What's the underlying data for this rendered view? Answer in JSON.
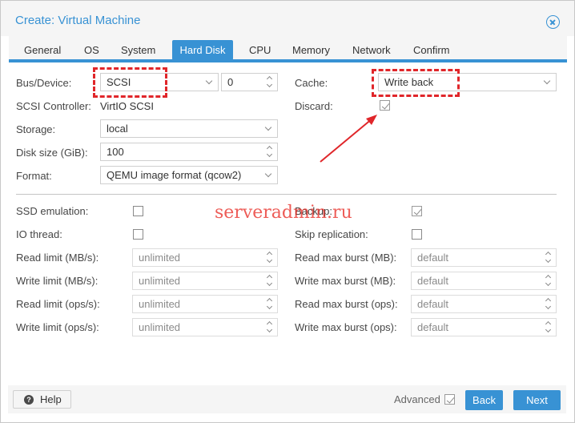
{
  "window": {
    "title": "Create: Virtual Machine"
  },
  "tabs": [
    {
      "label": "General",
      "active": false
    },
    {
      "label": "OS",
      "active": false
    },
    {
      "label": "System",
      "active": false
    },
    {
      "label": "Hard Disk",
      "active": true
    },
    {
      "label": "CPU",
      "active": false
    },
    {
      "label": "Memory",
      "active": false
    },
    {
      "label": "Network",
      "active": false
    },
    {
      "label": "Confirm",
      "active": false
    }
  ],
  "form": {
    "bus_device": {
      "label": "Bus/Device:",
      "bus": "SCSI",
      "device": "0"
    },
    "scsi_controller": {
      "label": "SCSI Controller:",
      "value": "VirtIO SCSI"
    },
    "storage": {
      "label": "Storage:",
      "value": "local"
    },
    "disk_size": {
      "label": "Disk size (GiB):",
      "value": "100"
    },
    "format": {
      "label": "Format:",
      "value": "QEMU image format (qcow2)"
    },
    "cache": {
      "label": "Cache:",
      "value": "Write back"
    },
    "discard": {
      "label": "Discard:",
      "checked": true
    }
  },
  "advanced_form": {
    "ssd_emulation": {
      "label": "SSD emulation:",
      "checked": false
    },
    "io_thread": {
      "label": "IO thread:",
      "checked": false
    },
    "read_limit_mb": {
      "label": "Read limit (MB/s):",
      "placeholder": "unlimited"
    },
    "write_limit_mb": {
      "label": "Write limit (MB/s):",
      "placeholder": "unlimited"
    },
    "read_limit_ops": {
      "label": "Read limit (ops/s):",
      "placeholder": "unlimited"
    },
    "write_limit_ops": {
      "label": "Write limit (ops/s):",
      "placeholder": "unlimited"
    },
    "backup": {
      "label": "Backup:",
      "checked": true
    },
    "skip_replication": {
      "label": "Skip replication:",
      "checked": false
    },
    "read_max_burst_mb": {
      "label": "Read max burst (MB):",
      "placeholder": "default"
    },
    "write_max_burst_mb": {
      "label": "Write max burst (MB):",
      "placeholder": "default"
    },
    "read_max_burst_ops": {
      "label": "Read max burst (ops):",
      "placeholder": "default"
    },
    "write_max_burst_ops": {
      "label": "Write max burst (ops):",
      "placeholder": "default"
    }
  },
  "footer": {
    "help_label": "Help",
    "help_icon_glyph": "?",
    "advanced_label": "Advanced",
    "advanced_checked": true,
    "back_label": "Back",
    "next_label": "Next"
  },
  "watermark": "serveradmin.ru",
  "colors": {
    "accent": "#3892d4",
    "annotation": "#e0262a"
  },
  "icons": [
    "close-icon",
    "help-icon",
    "chevron-down-icon",
    "spinner-icon",
    "checkbox-icon",
    "annotation-arrow-icon"
  ]
}
